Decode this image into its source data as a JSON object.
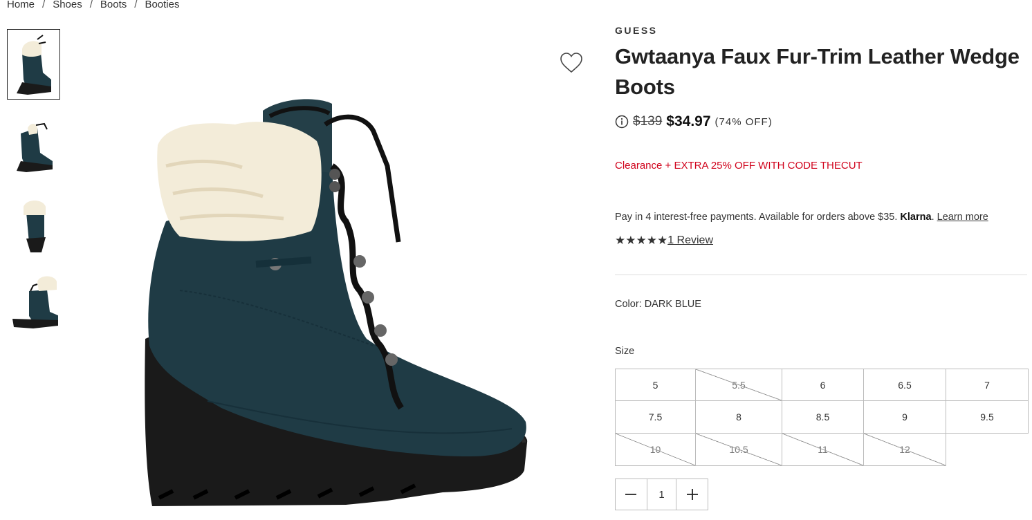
{
  "breadcrumb": [
    "Home",
    "Shoes",
    "Boots",
    "Booties"
  ],
  "product": {
    "brand": "GUESS",
    "title": "Gwtaanya Faux Fur-Trim Leather Wedge Boots",
    "original_price": "$139",
    "sale_price": "$34.97",
    "discount": "(74% OFF)",
    "promo": "Clearance + EXTRA 25% OFF WITH CODE THECUT",
    "klarna_text": "Pay in 4 interest-free payments. Available for orders above $35.",
    "klarna_brand": "Klarna",
    "klarna_link": "Learn more",
    "rating_stars": "★★★★★",
    "reviews": "1 Review",
    "color_label": "Color: DARK BLUE",
    "size_label": "Size",
    "quantity": "1"
  },
  "sizes": [
    {
      "label": "5",
      "available": true
    },
    {
      "label": "5.5",
      "available": false
    },
    {
      "label": "6",
      "available": true
    },
    {
      "label": "6.5",
      "available": true
    },
    {
      "label": "7",
      "available": true
    },
    {
      "label": "7.5",
      "available": true
    },
    {
      "label": "8",
      "available": true
    },
    {
      "label": "8.5",
      "available": true
    },
    {
      "label": "9",
      "available": true
    },
    {
      "label": "9.5",
      "available": true
    },
    {
      "label": "10",
      "available": false
    },
    {
      "label": "10.5",
      "available": false
    },
    {
      "label": "11",
      "available": false
    },
    {
      "label": "12",
      "available": false
    }
  ],
  "colors": {
    "promo": "#d0021b",
    "boot_suede": "#1f3b45",
    "fur": "#f3ecd9",
    "sole": "#1a1a1a"
  },
  "icons": {
    "favorite": "heart-outline-icon",
    "info": "info-circle-icon",
    "minus": "minus-icon",
    "plus": "plus-icon"
  }
}
